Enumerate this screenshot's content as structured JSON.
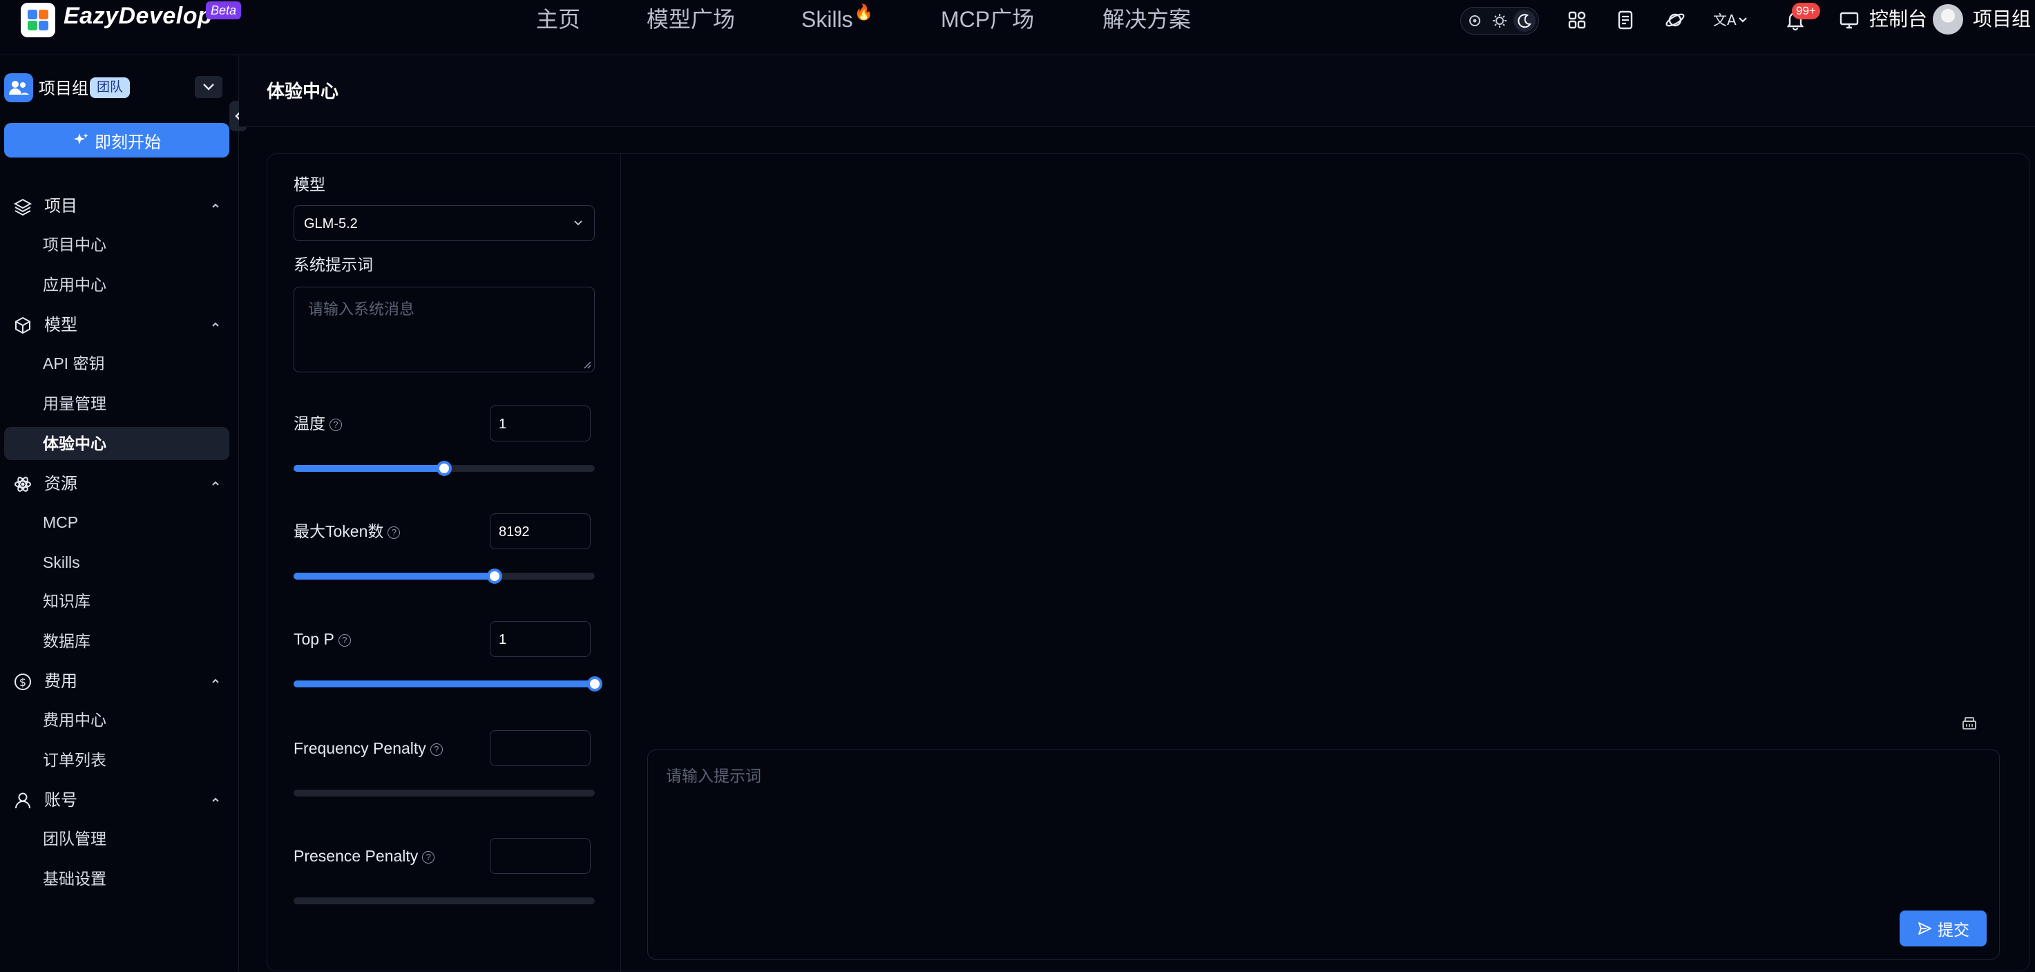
{
  "brand": {
    "name": "EazyDevelop",
    "badge": "Beta"
  },
  "nav": {
    "items": [
      "主页",
      "模型广场",
      "Skills",
      "MCP广场",
      "解决方案"
    ],
    "skills_badge_icon": "fire-icon"
  },
  "toolbar": {
    "theme_modes": [
      "system",
      "light",
      "dark"
    ],
    "active_theme": "dark",
    "notifications": "99+",
    "console_label": "控制台",
    "user_name": "项目组"
  },
  "sidebar": {
    "team_name": "项目组",
    "team_tag": "团队",
    "start_button": "即刻开始",
    "groups": [
      {
        "label": "项目",
        "icon": "layers-icon",
        "items": [
          "项目中心",
          "应用中心"
        ]
      },
      {
        "label": "模型",
        "icon": "cube-icon",
        "items": [
          "API 密钥",
          "用量管理",
          "体验中心"
        ]
      },
      {
        "label": "资源",
        "icon": "atom-icon",
        "items": [
          "MCP",
          "Skills",
          "知识库",
          "数据库"
        ]
      },
      {
        "label": "费用",
        "icon": "dollar-icon",
        "items": [
          "费用中心",
          "订单列表"
        ]
      },
      {
        "label": "账号",
        "icon": "user-icon",
        "items": [
          "团队管理",
          "基础设置"
        ]
      }
    ],
    "active_item": "体验中心"
  },
  "page": {
    "title": "体验中心"
  },
  "settings": {
    "model_label": "模型",
    "model_value": "GLM-5.2",
    "system_prompt_label": "系统提示词",
    "system_prompt_placeholder": "请输入系统消息",
    "temperature": {
      "label": "温度",
      "value": "1",
      "fill": 0.5
    },
    "max_tokens": {
      "label": "最大Token数",
      "value": "8192",
      "fill": 0.667
    },
    "top_p": {
      "label": "Top P",
      "value": "1",
      "fill": 1.0
    },
    "frequency_penalty": {
      "label": "Frequency Penalty",
      "value": "",
      "fill": 0
    },
    "presence_penalty": {
      "label": "Presence Penalty",
      "value": "",
      "fill": 0
    }
  },
  "chat": {
    "prompt_placeholder": "请输入提示词",
    "submit_label": "提交"
  },
  "colors": {
    "accent": "#3b82f6",
    "background": "#03060f",
    "badge": "#ef4444",
    "beta": "#7c3aed"
  }
}
